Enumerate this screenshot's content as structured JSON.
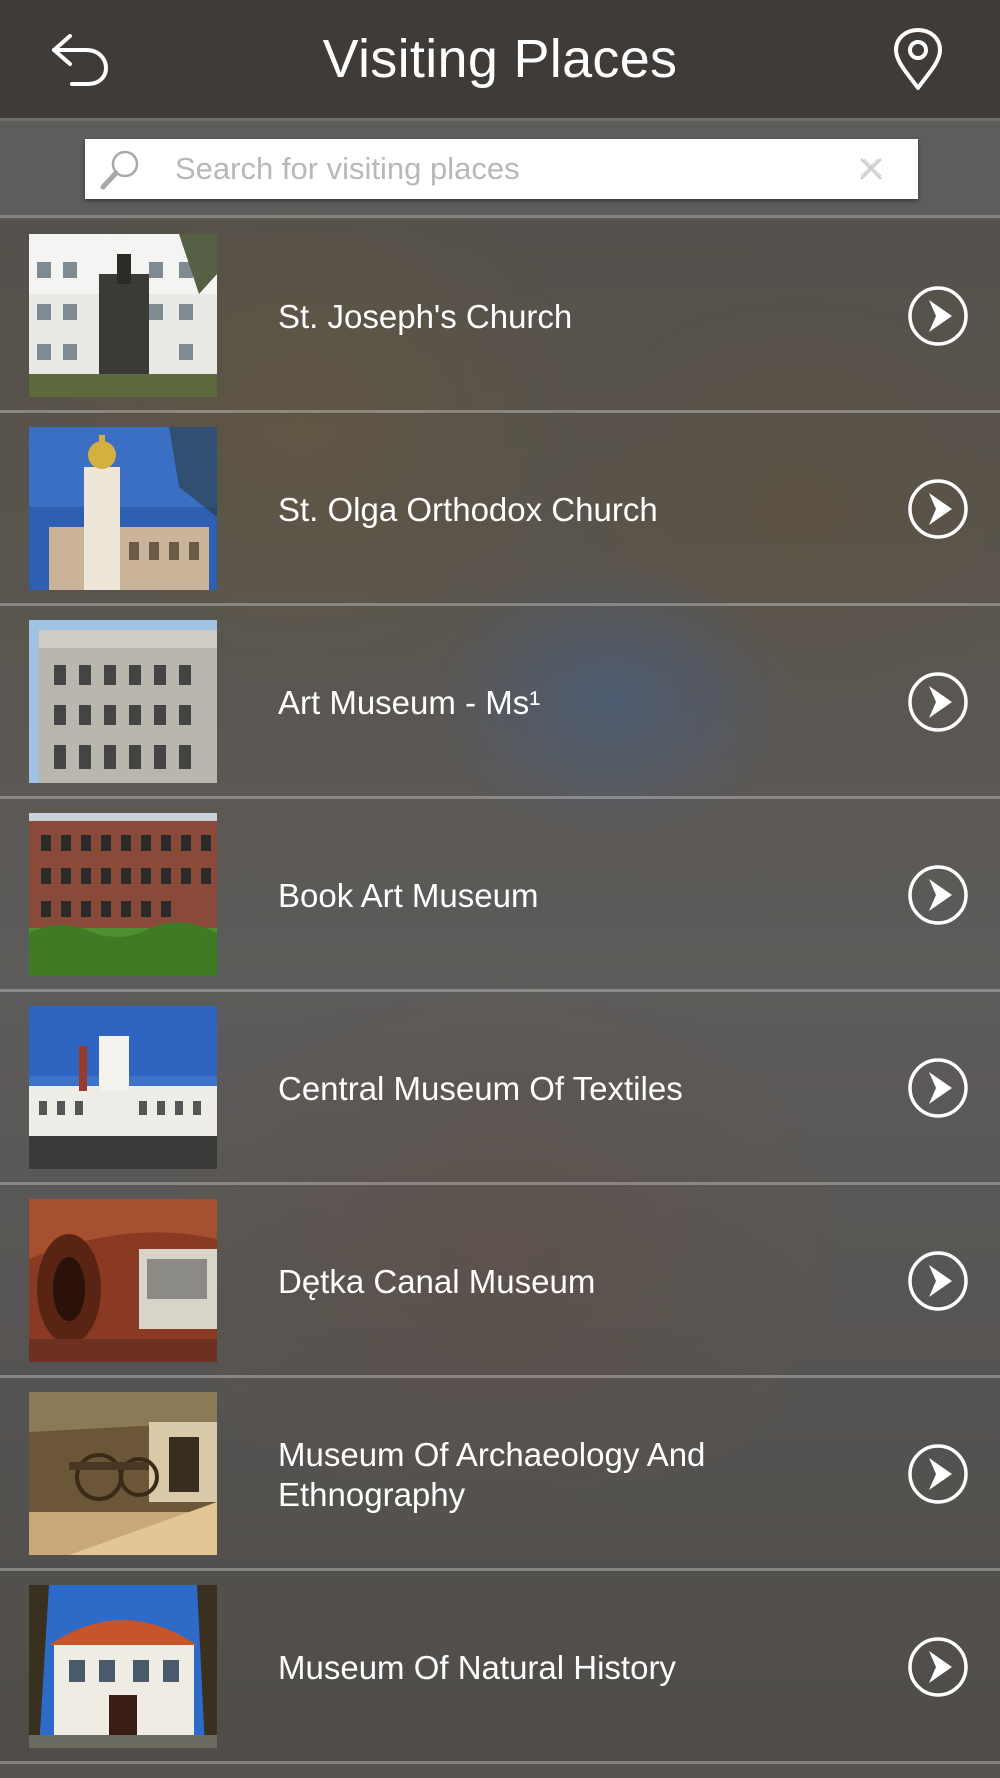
{
  "header": {
    "title": "Visiting Places",
    "back_icon": "back-arrow-icon",
    "map_icon": "map-pin-icon"
  },
  "search": {
    "placeholder": "Search for visiting places",
    "value": ""
  },
  "places": [
    {
      "name": "St. Joseph's Church"
    },
    {
      "name": "St. Olga Orthodox Church"
    },
    {
      "name": "Art Museum - Ms¹"
    },
    {
      "name": "Book Art Museum"
    },
    {
      "name": "Central Museum Of Textiles"
    },
    {
      "name": "Dętka Canal Museum"
    },
    {
      "name": "Museum Of Archaeology And Ethnography"
    },
    {
      "name": "Museum Of Natural History"
    }
  ],
  "colors": {
    "text": "#ffffff",
    "divider": "#d2d2d2",
    "search_bg": "#ffffff",
    "placeholder": "#b8b8b8"
  }
}
